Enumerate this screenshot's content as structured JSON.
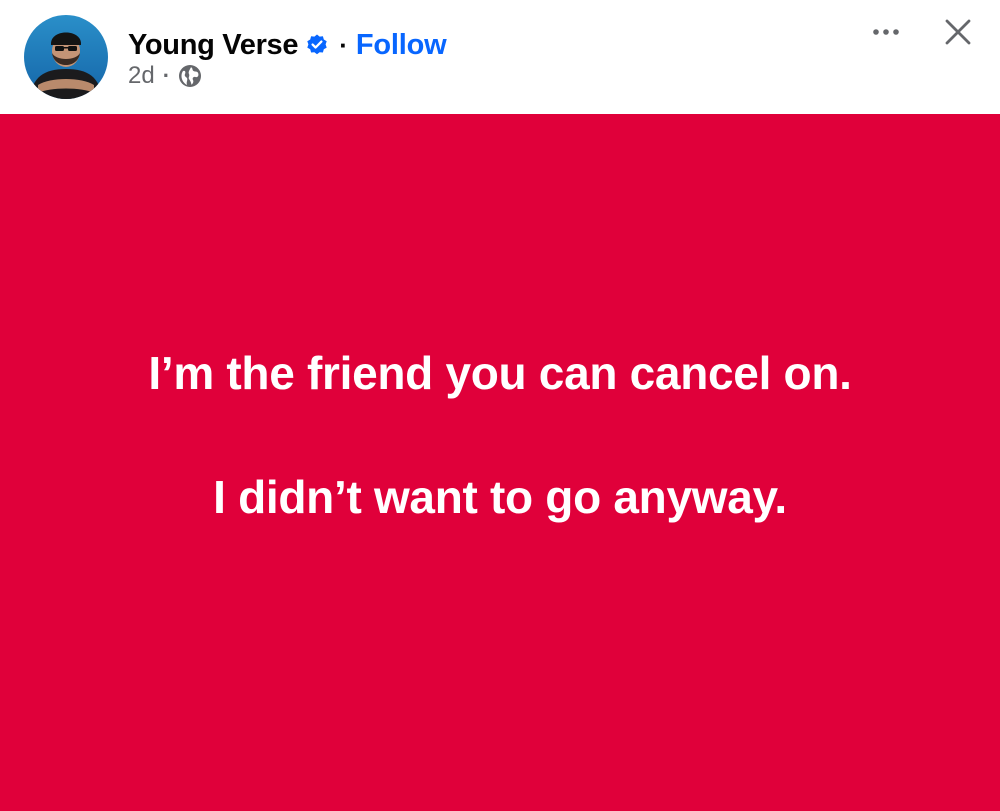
{
  "post": {
    "author": {
      "name": "Young Verse",
      "verified": true,
      "follow_label": "Follow",
      "separator": "·"
    },
    "meta": {
      "time": "2d",
      "separator": "·",
      "privacy_icon": "globe-icon"
    },
    "actions": {
      "more_icon": "more-options-icon",
      "close_icon": "close-icon"
    },
    "card": {
      "background_color": "#e0003a",
      "text_color": "#ffffff",
      "lines": [
        "I’m the friend you can cancel on.",
        "I didn’t want to go anyway."
      ]
    },
    "colors": {
      "link": "#0866ff",
      "verified_badge": "#0866ff",
      "secondary_text": "#65676b"
    }
  }
}
